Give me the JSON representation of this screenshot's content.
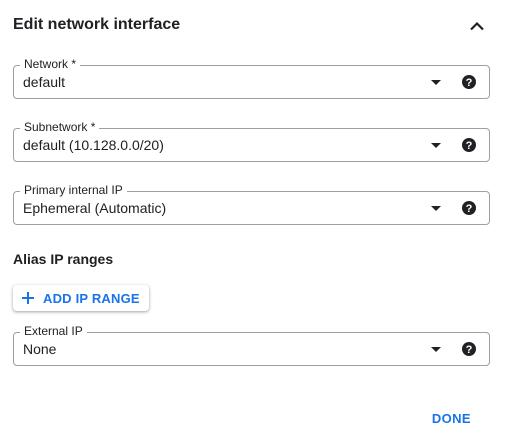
{
  "header": {
    "title": "Edit network interface"
  },
  "network": {
    "label": "Network *",
    "value": "default"
  },
  "subnetwork": {
    "label": "Subnetwork *",
    "value": "default (10.128.0.0/20)"
  },
  "primary_ip": {
    "label": "Primary internal IP",
    "value": "Ephemeral (Automatic)"
  },
  "alias": {
    "section_label": "Alias IP ranges",
    "add_button": "ADD IP RANGE"
  },
  "external_ip": {
    "label": "External IP",
    "value": "None"
  },
  "footer": {
    "done_label": "DONE"
  },
  "colors": {
    "accent": "#1a73e8",
    "text": "#202124",
    "border": "#9aa0a6"
  }
}
